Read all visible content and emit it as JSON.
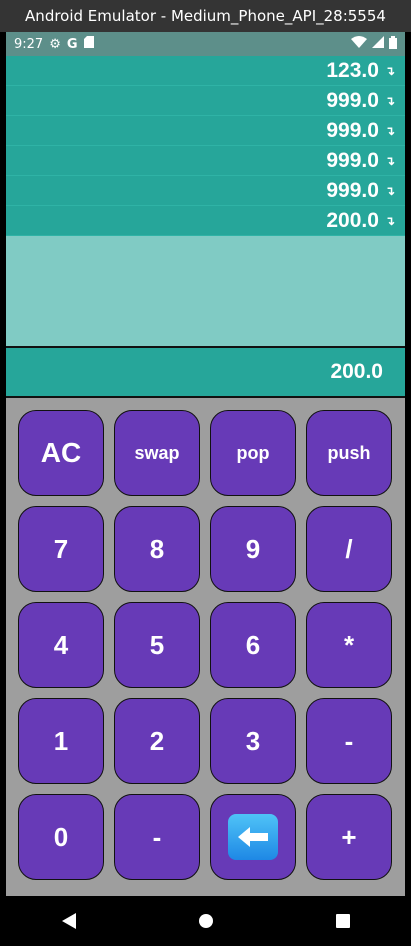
{
  "window": {
    "title": "Android Emulator - Medium_Phone_API_28:5554"
  },
  "status_bar": {
    "time": "9:27",
    "left_icons": [
      "gear-icon",
      "google-g-icon",
      "sd-card-icon"
    ],
    "right_icons": [
      "wifi-icon",
      "signal-icon",
      "battery-icon"
    ]
  },
  "stack": {
    "items": [
      {
        "value": "123.0",
        "icon": "arrow-down-right-icon"
      },
      {
        "value": "999.0",
        "icon": "arrow-down-right-icon"
      },
      {
        "value": "999.0",
        "icon": "arrow-down-right-icon"
      },
      {
        "value": "999.0",
        "icon": "arrow-down-right-icon"
      },
      {
        "value": "999.0",
        "icon": "arrow-down-right-icon"
      },
      {
        "value": "200.0",
        "icon": "arrow-down-right-icon"
      }
    ]
  },
  "display": {
    "value": "200.0"
  },
  "keypad": {
    "row1": [
      "AC",
      "swap",
      "pop",
      "push"
    ],
    "row2": [
      "7",
      "8",
      "9",
      "/"
    ],
    "row3": [
      "4",
      "5",
      "6",
      "*"
    ],
    "row4": [
      "1",
      "2",
      "3",
      "-"
    ],
    "row5": [
      "0",
      "-",
      "",
      "+"
    ]
  },
  "colors": {
    "stack_bg": "#26a69a",
    "stack_empty_bg": "#80cbc4",
    "key_bg": "#673ab7",
    "keypad_bg": "#9e9e9e"
  },
  "nav_bar": {
    "buttons": [
      "back-icon",
      "home-icon",
      "recents-icon"
    ]
  }
}
